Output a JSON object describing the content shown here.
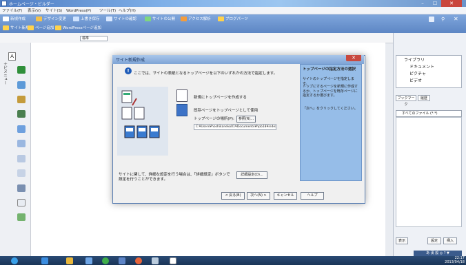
{
  "window": {
    "title": "ホームページ・ビルダー",
    "min": "–",
    "max": "☐",
    "close": "✕"
  },
  "menu": [
    "ファイル(F)",
    "表示(V)",
    "サイト(S)",
    "WordPress(P)",
    "ツール(T)",
    "ヘルプ(H)"
  ],
  "toolbar": {
    "row1": [
      "新規作成",
      "デザイン変更",
      "上書き保存",
      "サイトの確認",
      "サイトの公開",
      "アクセス解析",
      "ブログパーツ"
    ],
    "row2": [
      "サイト新規",
      "ページ追加",
      "WordPressページ追加"
    ],
    "tag_select": "標準"
  },
  "leftbar": {
    "label": "ナビメニュー"
  },
  "dialog": {
    "title": "サイト新規作成",
    "close": "✕",
    "instruction": "ここでは、サイトの表紙となるトップページを以下のいずれかの方法で指定します。",
    "option_new": "新規にトップページを作成する",
    "option_existing": "既存ページをトップページとして使用",
    "path_label": "トップページの場所(P):",
    "browse": "参照(R)...",
    "path_value": "C:¥Users¥hoshikaneko01¥Documents¥hpb18¥index",
    "detail_text": "サイトに関して、詳細な設定を行う場合は、「詳細設定」ボタンで設定を行うことができます。",
    "detail_button": "詳細設定(D)...",
    "help_title": "トップページの指定方法の選択",
    "help_sub": "サイトのトップページを指定します。",
    "help_body": "トップにするページを新規に作成するか、トップページを既存ページに指定するか選びます。",
    "help_next": "「次へ」をクリックしてください。",
    "back": "< 戻る(B)",
    "next": "次へ(N) >",
    "cancel": "キャンセル",
    "help": "ヘルプ"
  },
  "right": {
    "tree": [
      "ライブラリ",
      "ドキュメント",
      "ピクチャ",
      "ビデオ"
    ],
    "tab1": "ブックマーク",
    "tab2": "履歴",
    "dropdown": "すべてのファイル (*.*)",
    "btn_view": "表示",
    "btn_settings": "設定",
    "btn_insert": "挿入"
  },
  "taskbar": {
    "ime": "あ 漢 般 ◎ ? ▼",
    "time": "22:17",
    "date": "2013/04/18"
  }
}
